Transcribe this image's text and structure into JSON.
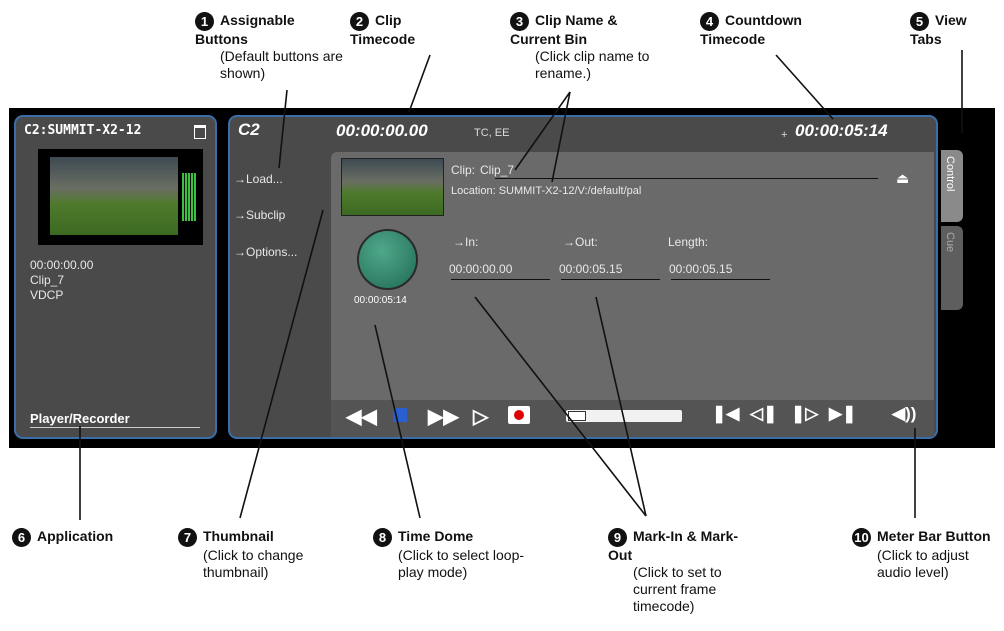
{
  "callouts": [
    {
      "num": "1",
      "title": "Assignable Buttons",
      "sub": "(Default buttons are shown)"
    },
    {
      "num": "2",
      "title": "Clip Timecode",
      "sub": ""
    },
    {
      "num": "3",
      "title": "Clip Name & Current Bin",
      "sub": "(Click clip name to rename.)"
    },
    {
      "num": "4",
      "title": "Countdown Timecode",
      "sub": ""
    },
    {
      "num": "5",
      "title": "View Tabs",
      "sub": ""
    },
    {
      "num": "6",
      "title": "Application",
      "sub": ""
    },
    {
      "num": "7",
      "title": "Thumbnail",
      "sub": "(Click to change thumbnail)"
    },
    {
      "num": "8",
      "title": "Time Dome",
      "sub": "(Click to select loop-play mode)"
    },
    {
      "num": "9",
      "title": "Mark-In & Mark-Out",
      "sub": "(Click to set to current frame timecode)"
    },
    {
      "num": "10",
      "title": "Meter Bar Button",
      "sub": "(Click to adjust audio level)"
    }
  ],
  "left_panel": {
    "title": "C2:SUMMIT-X2-12",
    "timecode": "00:00:00.00",
    "clip": "Clip_7",
    "protocol": "VDCP",
    "app": "Player/Recorder"
  },
  "right_panel": {
    "channel": "C2",
    "clip_timecode": "00:00:00.00",
    "tc_label": "TC, EE",
    "countdown": "00:00:05:14",
    "buttons": [
      "→Load...",
      "→Subclip",
      "→Options..."
    ],
    "clip_label": "Clip:",
    "clip_name": "Clip_7",
    "location": "Location: SUMMIT-X2-12/V:/default/pal",
    "in_label": "→In:",
    "out_label": "→Out:",
    "length_label": "Length:",
    "in_value": "00:00:00.00",
    "out_value": "00:00:05.15",
    "length_value": "00:00:05.15",
    "dome_time": "00:00:05:14",
    "tabs": [
      "Control",
      "Cue"
    ]
  }
}
